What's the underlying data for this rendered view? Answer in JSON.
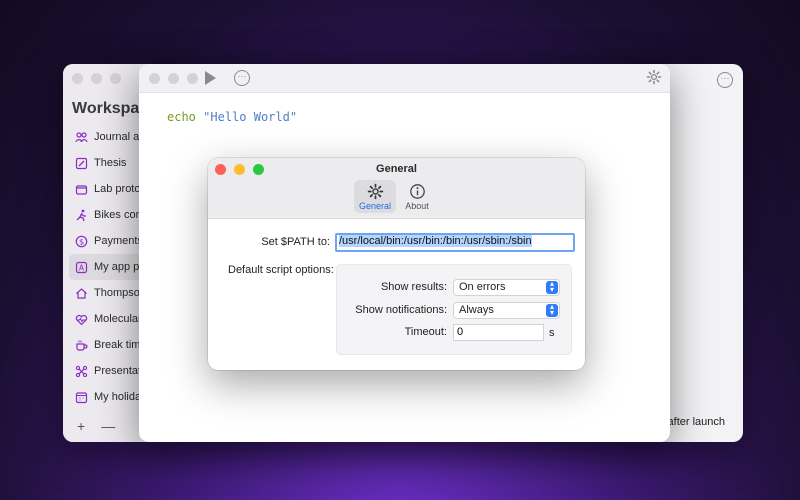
{
  "back_window": {
    "sidebar_title": "Workspace",
    "items": [
      {
        "label": "Journal and notes",
        "icon": "people-icon"
      },
      {
        "label": "Thesis",
        "icon": "pencil-note-icon"
      },
      {
        "label": "Lab protocols",
        "icon": "folder-icon"
      },
      {
        "label": "Bikes config",
        "icon": "runner-icon"
      },
      {
        "label": "Payments",
        "icon": "dollar-icon"
      },
      {
        "label": "My app project",
        "icon": "app-a-icon"
      },
      {
        "label": "Thompson",
        "icon": "house-icon"
      },
      {
        "label": "Molecular",
        "icon": "heart-pulse-icon"
      },
      {
        "label": "Break time",
        "icon": "coffee-icon"
      },
      {
        "label": "Presentation",
        "icon": "network-icon"
      },
      {
        "label": "My holidays",
        "icon": "calendar-icon"
      }
    ],
    "add_label": "+",
    "remove_label": "—",
    "more_label": "···",
    "footer_text": "after launch"
  },
  "editor": {
    "more_label": "···",
    "code_keyword": "echo",
    "code_space": " ",
    "code_string": "\"Hello World\""
  },
  "dialog": {
    "title": "General",
    "tabs": [
      {
        "label": "General",
        "icon": "gear-icon",
        "active": true
      },
      {
        "label": "About",
        "icon": "info-icon",
        "active": false
      }
    ],
    "path_label": "Set $PATH to:",
    "path_value": "/usr/local/bin:/usr/bin:/bin:/usr/sbin:/sbin",
    "options_label": "Default script options:",
    "show_results_label": "Show results:",
    "show_results_value": "On errors",
    "show_notifications_label": "Show notifications:",
    "show_notifications_value": "Always",
    "timeout_label": "Timeout:",
    "timeout_value": "0",
    "timeout_unit": "s"
  },
  "colors": {
    "accent": "#2e7cf6",
    "icon_purple": "#8a2cc4",
    "close": "#ff5f57",
    "minimize": "#febc2e",
    "zoom": "#28c840"
  }
}
